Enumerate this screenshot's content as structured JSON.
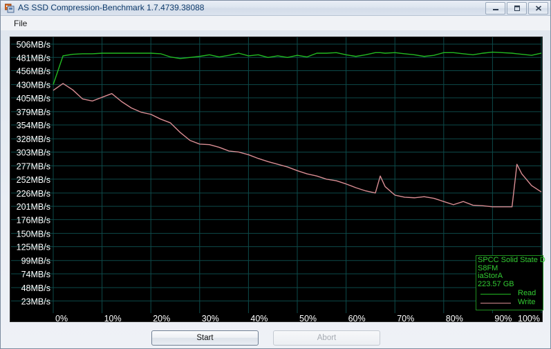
{
  "window": {
    "title": "AS SSD Compression-Benchmark 1.7.4739.38088",
    "icon": "app-icon",
    "minimize_label": "–",
    "maximize_label": "□",
    "close_label": "✕"
  },
  "menu": {
    "items": [
      {
        "label": "File"
      }
    ]
  },
  "legend": {
    "device_line1": "SPCC Solid State D",
    "device_line2": "S8FM",
    "controller": "iaStorA",
    "capacity": "223.57 GB",
    "entries": [
      {
        "label": "Read",
        "color": "#22bb22"
      },
      {
        "label": "Write",
        "color": "#d98d93"
      }
    ]
  },
  "buttons": {
    "start": "Start",
    "abort": "Abort"
  },
  "chart_data": {
    "type": "line",
    "title": "AS SSD Compression-Benchmark",
    "xlabel": "",
    "ylabel": "",
    "grid": true,
    "legend_position": "bottom-right",
    "xlim": [
      0,
      100
    ],
    "ylim": [
      0,
      519
    ],
    "xtick_labels": [
      "0%",
      "10%",
      "20%",
      "30%",
      "40%",
      "50%",
      "60%",
      "70%",
      "80%",
      "90%",
      "100%"
    ],
    "xticks": [
      0,
      10,
      20,
      30,
      40,
      50,
      60,
      70,
      80,
      90,
      100
    ],
    "ytick_labels": [
      "506MB/s",
      "481MB/s",
      "456MB/s",
      "430MB/s",
      "405MB/s",
      "379MB/s",
      "354MB/s",
      "328MB/s",
      "303MB/s",
      "277MB/s",
      "252MB/s",
      "226MB/s",
      "201MB/s",
      "176MB/s",
      "150MB/s",
      "125MB/s",
      "99MB/s",
      "74MB/s",
      "48MB/s",
      "23MB/s"
    ],
    "yticks": [
      506,
      481,
      456,
      430,
      405,
      379,
      354,
      328,
      303,
      277,
      252,
      226,
      201,
      176,
      150,
      125,
      99,
      74,
      48,
      23
    ],
    "x": [
      0,
      2,
      4,
      6,
      8,
      10,
      12,
      14,
      16,
      18,
      20,
      22,
      24,
      26,
      28,
      30,
      32,
      34,
      36,
      38,
      40,
      42,
      44,
      46,
      48,
      50,
      52,
      54,
      56,
      58,
      60,
      62,
      64,
      66,
      67,
      68,
      70,
      72,
      74,
      76,
      78,
      80,
      82,
      84,
      86,
      88,
      90,
      92,
      94,
      95,
      96,
      98,
      100
    ],
    "series": [
      {
        "name": "Read",
        "color": "#22bb22",
        "values": [
          430,
          484,
          487,
          488,
          488,
          489,
          489,
          489,
          489,
          489,
          489,
          488,
          482,
          479,
          481,
          483,
          486,
          482,
          485,
          489,
          484,
          486,
          481,
          484,
          481,
          485,
          482,
          489,
          489,
          490,
          486,
          483,
          486,
          490,
          490,
          489,
          490,
          488,
          486,
          483,
          485,
          490,
          490,
          488,
          486,
          489,
          491,
          490,
          489,
          488,
          487,
          485,
          489
        ]
      },
      {
        "name": "Write",
        "color": "#d98d93",
        "values": [
          419,
          432,
          420,
          403,
          399,
          406,
          413,
          398,
          386,
          378,
          374,
          365,
          358,
          340,
          325,
          318,
          317,
          312,
          305,
          303,
          298,
          291,
          285,
          280,
          275,
          268,
          262,
          258,
          252,
          249,
          243,
          236,
          230,
          226,
          258,
          238,
          222,
          218,
          217,
          219,
          216,
          210,
          204,
          210,
          203,
          202,
          200,
          200,
          200,
          280,
          262,
          240,
          228
        ]
      }
    ]
  }
}
